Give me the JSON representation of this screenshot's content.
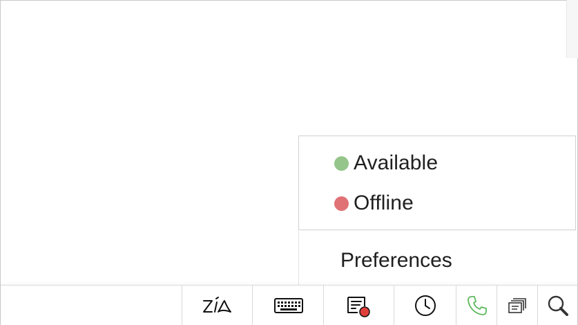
{
  "status_menu": {
    "items": [
      {
        "label": "Available",
        "color": "#95c58a"
      },
      {
        "label": "Offline",
        "color": "#e07175"
      }
    ],
    "preferences_label": "Preferences"
  },
  "toolbar": {
    "buttons": [
      {
        "icon": "zia-icon"
      },
      {
        "icon": "keyboard-icon"
      },
      {
        "icon": "notes-icon",
        "badge_color": "#e0403a"
      },
      {
        "icon": "clock-icon"
      },
      {
        "icon": "phone-icon",
        "color": "#5cb85c"
      },
      {
        "icon": "chats-icon"
      },
      {
        "icon": "search-icon"
      }
    ]
  }
}
